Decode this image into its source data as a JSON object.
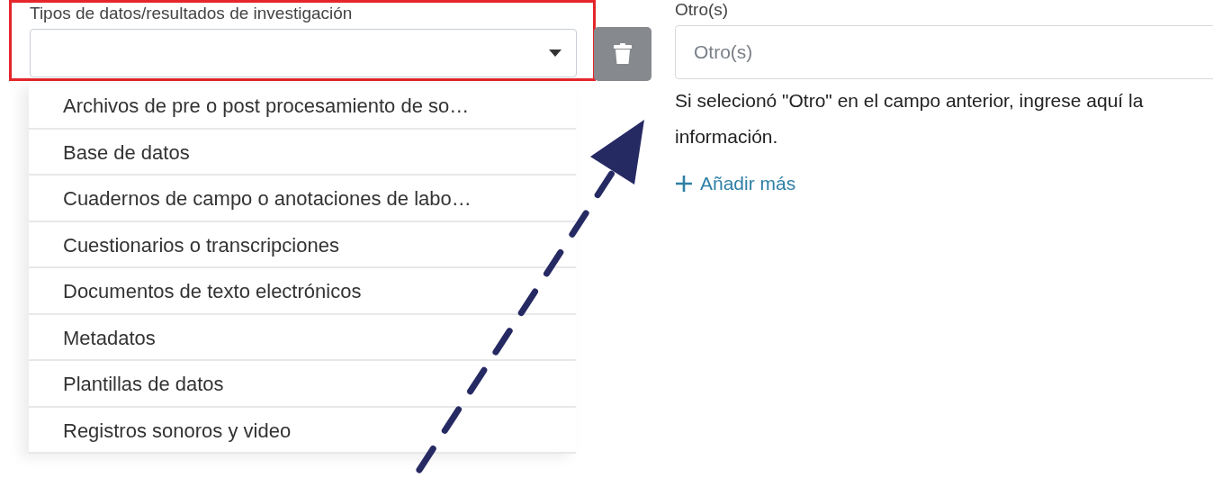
{
  "left_field": {
    "label": "Tipos de datos/resultados de investigación",
    "expanded": true,
    "options": [
      {
        "label": "Archivos de pre o post procesamiento de so…"
      },
      {
        "label": "Base de datos"
      },
      {
        "label": "Cuadernos de campo o anotaciones de labo…"
      },
      {
        "label": "Cuestionarios o transcripciones"
      },
      {
        "label": "Documentos de texto electrónicos"
      },
      {
        "label": "Metadatos"
      },
      {
        "label": "Plantillas de datos"
      },
      {
        "label": "Registros sonoros y video"
      }
    ]
  },
  "right_field": {
    "label": "Otro(s)",
    "placeholder": "Otro(s)",
    "help": "Si selecionó \"Otro\" en el campo anterior, ingrese aquí la información.",
    "add_link": "Añadir más"
  }
}
